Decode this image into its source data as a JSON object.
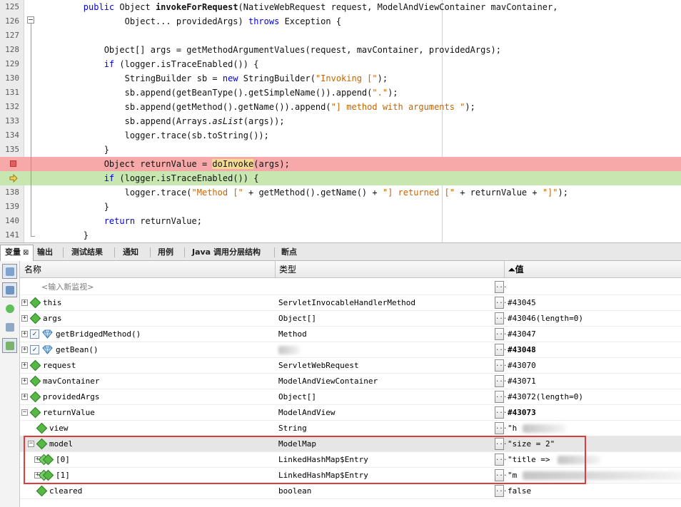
{
  "editor": {
    "lines": [
      {
        "num": "125",
        "code": [
          "        ",
          {
            "kw": "public"
          },
          " Object ",
          {
            "b": "invokeForRequest"
          },
          "(NativeWebRequest request, ModelAndViewContainer mavContainer,"
        ]
      },
      {
        "num": "126",
        "code": [
          "                Object... providedArgs) ",
          {
            "kw": "throws"
          },
          " Exception {"
        ]
      },
      {
        "num": "127",
        "code": [
          ""
        ]
      },
      {
        "num": "128",
        "code": [
          "            Object[] args = getMethodArgumentValues(request, mavContainer, providedArgs);"
        ]
      },
      {
        "num": "129",
        "code": [
          "            ",
          {
            "kw": "if"
          },
          " (logger.isTraceEnabled()) {"
        ]
      },
      {
        "num": "130",
        "code": [
          "                StringBuilder sb = ",
          {
            "kw": "new"
          },
          " StringBuilder(",
          {
            "s": "\"Invoking [\""
          },
          ");"
        ]
      },
      {
        "num": "131",
        "code": [
          "                sb.append(getBeanType().getSimpleName()).append(",
          {
            "s": "\".\""
          },
          ");"
        ]
      },
      {
        "num": "132",
        "code": [
          "                sb.append(getMethod().getName()).append(",
          {
            "s": "\"] method with arguments \""
          },
          ");"
        ]
      },
      {
        "num": "133",
        "code": [
          "                sb.append(Arrays.",
          {
            "i": "asList"
          },
          "(args));"
        ]
      },
      {
        "num": "134",
        "code": [
          "                logger.trace(sb.toString());"
        ]
      },
      {
        "num": "135",
        "code": [
          "            }"
        ]
      },
      {
        "num": "",
        "marker": "breakpoint",
        "code": [
          "            Object returnValue = ",
          {
            "h": "doInvoke"
          },
          "(args);"
        ]
      },
      {
        "num": "",
        "marker": "pc",
        "code": [
          "            ",
          {
            "kw": "if"
          },
          " (logger.isTraceEnabled()) {"
        ]
      },
      {
        "num": "138",
        "code": [
          "                logger.trace(",
          {
            "s": "\"Method [\""
          },
          " + getMethod().getName() + ",
          {
            "s": "\"] returned [\""
          },
          " + returnValue + ",
          {
            "s": "\"]\""
          },
          ");"
        ]
      },
      {
        "num": "139",
        "code": [
          "            }"
        ]
      },
      {
        "num": "140",
        "code": [
          "            ",
          {
            "kw": "return"
          },
          " returnValue;"
        ]
      },
      {
        "num": "141",
        "code": [
          "        }"
        ]
      }
    ]
  },
  "tabs": [
    {
      "label": "变量",
      "close": "⊠",
      "active": true
    },
    {
      "label": "输出"
    },
    {
      "label": "测试结果"
    },
    {
      "label": "通知"
    },
    {
      "label": "用例"
    },
    {
      "label": "Java 调用分层结构"
    },
    {
      "label": "断点"
    }
  ],
  "table": {
    "col_name": "名称",
    "col_type": "类型",
    "col_value": "值",
    "sort_indicator": "⏶",
    "watch_placeholder": "<输入新监视>",
    "rows": [
      {
        "name": "this",
        "type": "ServletInvocableHandlerMethod",
        "value": "#43045",
        "expand": "+",
        "icon": "green-diamond",
        "indent": 0
      },
      {
        "name": "args",
        "type": "Object[]",
        "value": "#43046(length=0)",
        "expand": "+",
        "icon": "green-diamond",
        "indent": 0
      },
      {
        "name": "getBridgedMethod()",
        "type": "Method",
        "value": "#43047",
        "expand": "+",
        "check": "✓",
        "icon": "blue-gem",
        "indent": 0
      },
      {
        "name": "getBean()",
        "type": "",
        "value": "#43048",
        "value_bold": true,
        "expand": "+",
        "check": "✓",
        "icon": "blue-gem",
        "indent": 0,
        "type_blurred": true
      },
      {
        "name": "request",
        "type": "ServletWebRequest",
        "value": "#43070",
        "expand": "+",
        "icon": "green-diamond",
        "indent": 0
      },
      {
        "name": "mavContainer",
        "type": "ModelAndViewContainer",
        "value": "#43071",
        "expand": "+",
        "icon": "green-diamond",
        "indent": 0
      },
      {
        "name": "providedArgs",
        "type": "Object[]",
        "value": "#43072(length=0)",
        "expand": "+",
        "icon": "green-diamond",
        "indent": 0
      },
      {
        "name": "returnValue",
        "type": "ModelAndView",
        "value": "#43073",
        "value_bold": true,
        "expand": "−",
        "icon": "green-diamond",
        "indent": 0
      },
      {
        "name": "view",
        "type": "String",
        "value": "\"h",
        "icon": "green-diamond",
        "indent": 1,
        "value_blurred": true
      },
      {
        "name": "model",
        "type": "ModelMap",
        "value": "\"size = 2\"",
        "expand": "−",
        "icon": "green-diamond",
        "indent": 1,
        "selected": true
      },
      {
        "name": "[0]",
        "type": "LinkedHashMap$Entry",
        "value": "\"title =>",
        "expand": "+",
        "icon": "green-diamond-2",
        "indent": 2,
        "value_blurred": true
      },
      {
        "name": "[1]",
        "type": "LinkedHashMap$Entry",
        "value": "\"m",
        "expand": "+",
        "icon": "green-diamond-2",
        "indent": 2,
        "value_blurred": true
      },
      {
        "name": "cleared",
        "type": "boolean",
        "value": "false",
        "icon": "green-diamond",
        "indent": 1
      }
    ]
  },
  "toolbar_icons": [
    "watch-icon",
    "watch-active-icon",
    "add-watch-icon",
    "settings-icon",
    "layout-icon"
  ],
  "colors": {
    "breakpoint_line": "#f7a9a9",
    "current_line": "#c8e6b0",
    "keyword": "#0000e6",
    "string": "#c86400",
    "highlight_box": "#e23b3b"
  }
}
